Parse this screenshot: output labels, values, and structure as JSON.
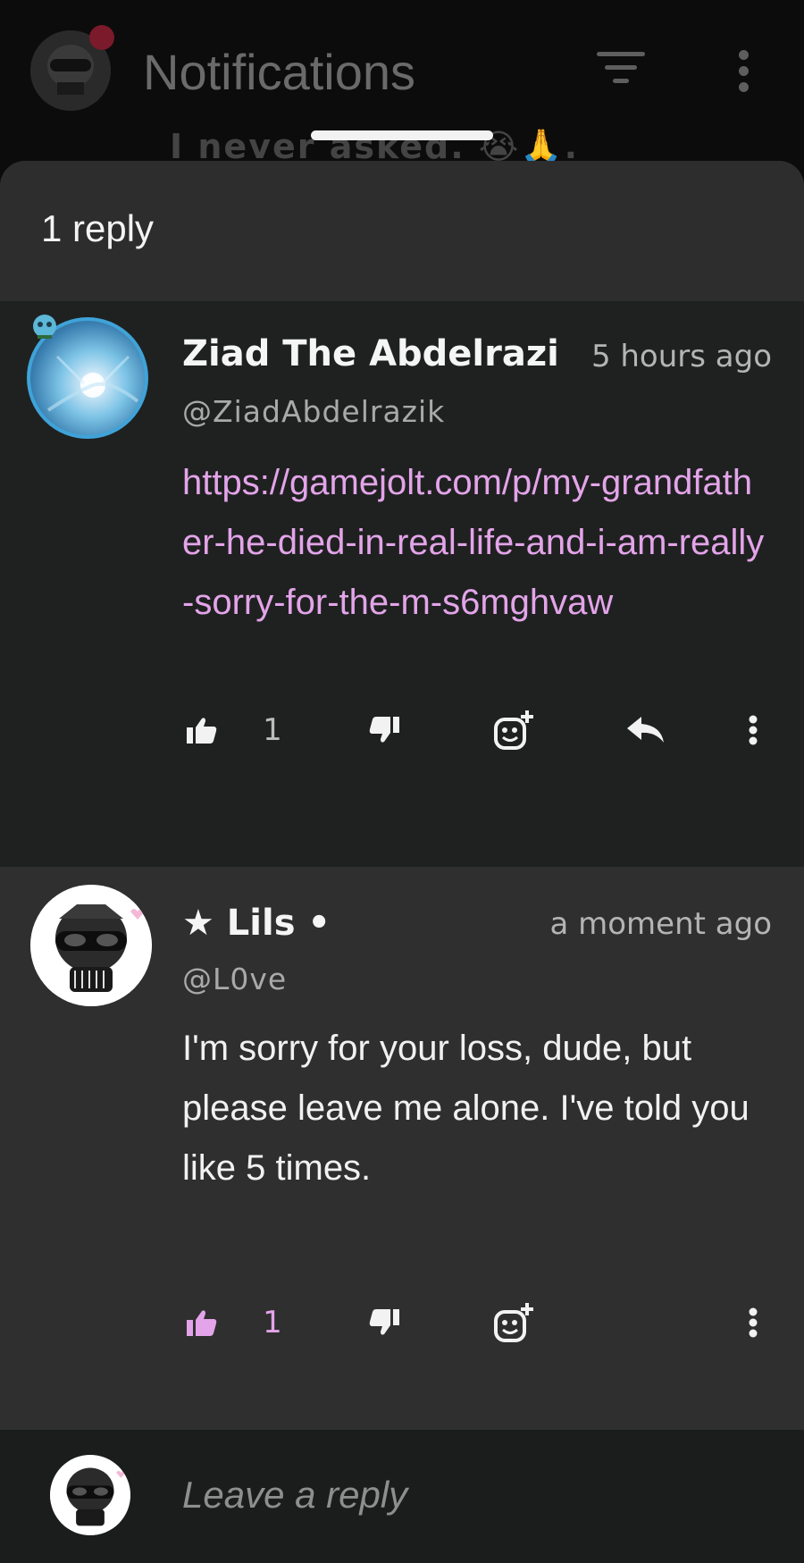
{
  "background": {
    "title": "Notifications",
    "snippet": "I never asked. 😭🙏."
  },
  "sheet": {
    "title": "1 reply"
  },
  "comments": [
    {
      "name": "Ziad The Abdelrazi",
      "time": "5 hours ago",
      "handle": "@ZiadAbdelrazik",
      "body": "https://gamejolt.com/p/my-grandfather-he-died-in-real-life-and-i-am-really-sorry-for-the-m-s6mghvaw",
      "like_count": "1",
      "liked": false
    },
    {
      "name": "★ Lils •",
      "time": "a moment ago",
      "handle": "@L0ve",
      "body": "I'm sorry for your loss, dude, but please leave me alone. I've told you like 5 times.",
      "like_count": "1",
      "liked": true
    }
  ],
  "reply": {
    "placeholder": "Leave a reply"
  },
  "colors": {
    "accent_pink": "#e3a4e9",
    "icon_white": "#f2f2f2",
    "sheet_bg": "#212121"
  }
}
